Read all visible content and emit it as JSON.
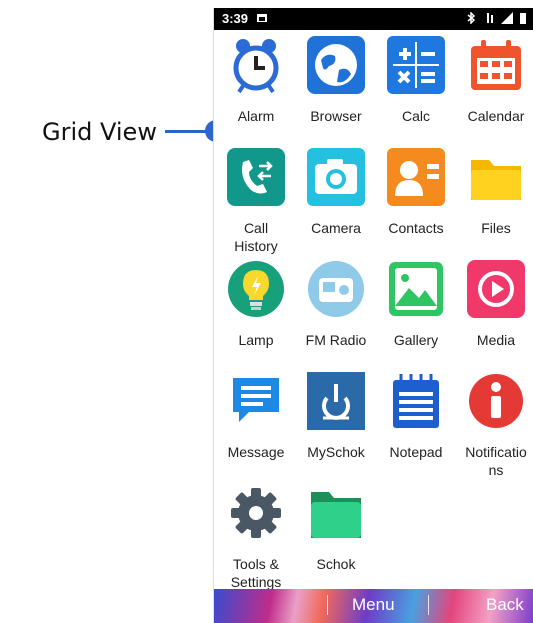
{
  "callout": {
    "label": "Grid View"
  },
  "status": {
    "time": "3:39"
  },
  "apps": [
    {
      "label": "Alarm"
    },
    {
      "label": "Browser"
    },
    {
      "label": "Calc"
    },
    {
      "label": "Calendar"
    },
    {
      "label": "Call\nHistory"
    },
    {
      "label": "Camera"
    },
    {
      "label": "Contacts"
    },
    {
      "label": "Files"
    },
    {
      "label": "Lamp"
    },
    {
      "label": "FM Radio"
    },
    {
      "label": "Gallery"
    },
    {
      "label": "Media"
    },
    {
      "label": "Message"
    },
    {
      "label": "MySchok"
    },
    {
      "label": "Notepad"
    },
    {
      "label": "Notificatio\nns"
    },
    {
      "label": "Tools &\nSettings"
    },
    {
      "label": "Schok"
    }
  ],
  "bottom_bar": {
    "menu_label": "Menu",
    "back_label": "Back"
  }
}
